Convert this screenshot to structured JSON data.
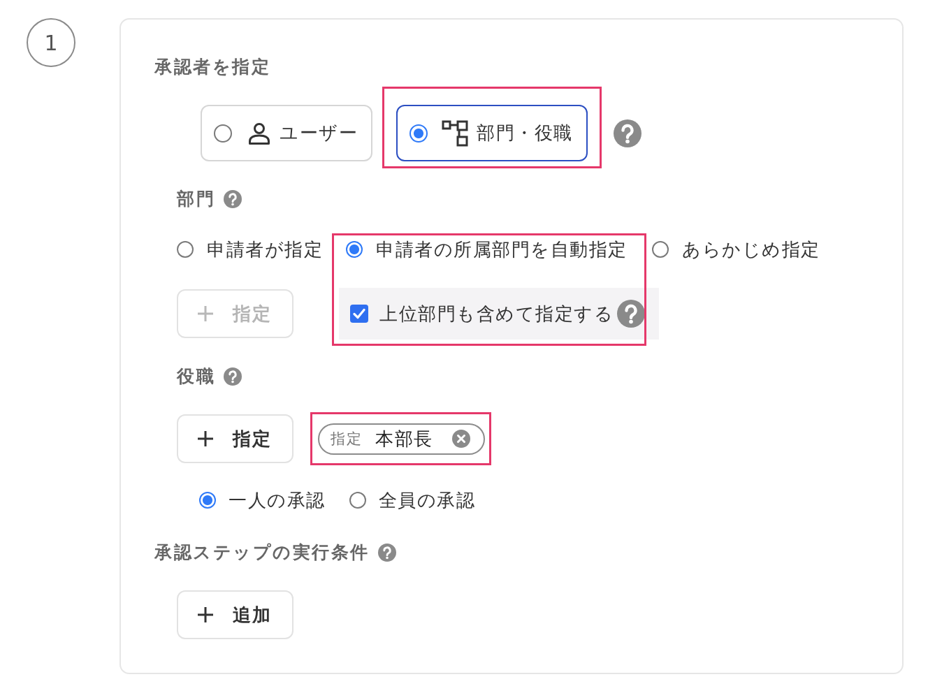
{
  "step": {
    "number": "1"
  },
  "approver": {
    "title": "承認者を指定",
    "types": [
      {
        "kind": "user",
        "label": "ユーザー",
        "selected": false,
        "highlighted": false
      },
      {
        "kind": "org",
        "label": "部門・役職",
        "selected": true,
        "highlighted": true
      }
    ]
  },
  "department": {
    "label": "部門",
    "options": [
      {
        "label": "申請者が指定",
        "selected": false,
        "highlighted": false
      },
      {
        "label": "申請者の所属部門を自動指定",
        "selected": true,
        "highlighted": true,
        "sub_option": {
          "label": "上位部門も含めて指定する",
          "checked": true
        }
      },
      {
        "label": "あらかじめ指定",
        "selected": false,
        "highlighted": false
      }
    ],
    "add_button": {
      "label": "指定",
      "disabled": true
    }
  },
  "position": {
    "label": "役職",
    "add_button": {
      "label": "指定",
      "disabled": false
    },
    "chips": [
      {
        "tag": "指定",
        "label": "本部長",
        "highlighted": true
      }
    ],
    "modes": [
      {
        "label": "一人の承認",
        "selected": true
      },
      {
        "label": "全員の承認",
        "selected": false
      }
    ]
  },
  "conditions": {
    "title": "承認ステップの実行条件",
    "add_button": {
      "label": "追加",
      "disabled": false
    }
  }
}
